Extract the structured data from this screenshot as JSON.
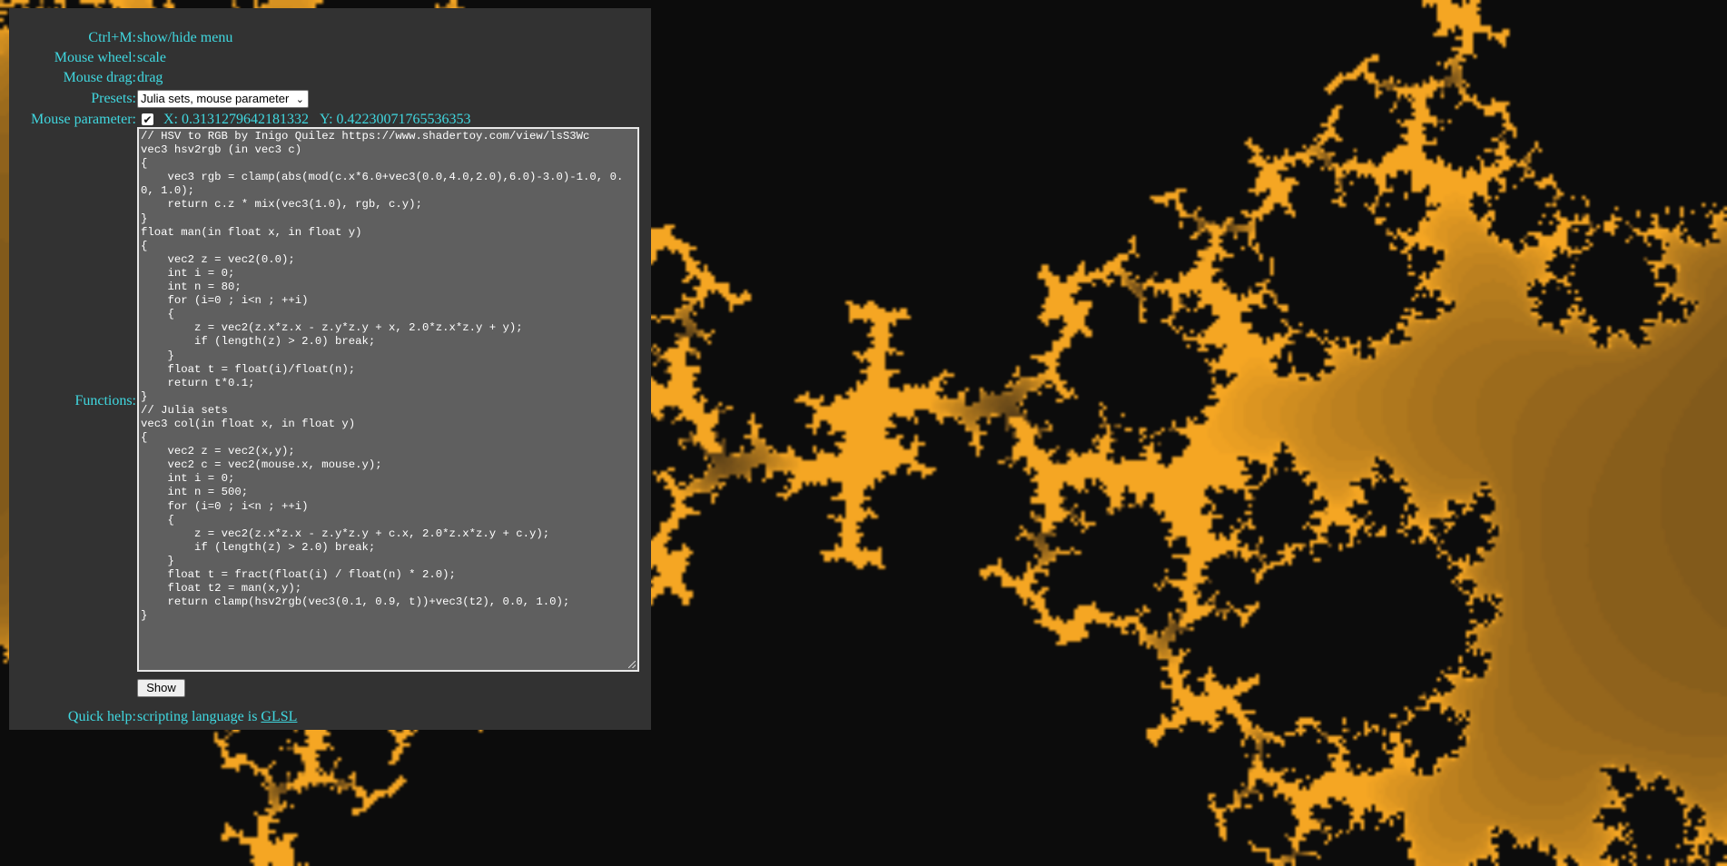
{
  "help": [
    {
      "key": "Ctrl+M:",
      "value": "show/hide menu"
    },
    {
      "key": "Mouse wheel:",
      "value": "scale"
    },
    {
      "key": "Mouse drag:",
      "value": "drag"
    }
  ],
  "presets": {
    "label": "Presets:",
    "selected": "Julia sets, mouse parameter"
  },
  "mouse_param": {
    "label": "Mouse parameter:",
    "checked": true,
    "x": "X: 0.3131279642181332",
    "y": "Y: 0.42230071765536353"
  },
  "functions": {
    "label": "Functions:",
    "code": "// HSV to RGB by Inigo Quilez https://www.shadertoy.com/view/lsS3Wc\nvec3 hsv2rgb (in vec3 c)\n{\n    vec3 rgb = clamp(abs(mod(c.x*6.0+vec3(0.0,4.0,2.0),6.0)-3.0)-1.0, 0.0, 1.0);\n    return c.z * mix(vec3(1.0), rgb, c.y);\n}\nfloat man(in float x, in float y)\n{\n    vec2 z = vec2(0.0);\n    int i = 0;\n    int n = 80;\n    for (i=0 ; i<n ; ++i)\n    {\n        z = vec2(z.x*z.x - z.y*z.y + x, 2.0*z.x*z.y + y);\n        if (length(z) > 2.0) break;\n    }\n    float t = float(i)/float(n);\n    return t*0.1;\n}\n// Julia sets\nvec3 col(in float x, in float y)\n{\n    vec2 z = vec2(x,y);\n    vec2 c = vec2(mouse.x, mouse.y);\n    int i = 0;\n    int n = 500;\n    for (i=0 ; i<n ; ++i)\n    {\n        z = vec2(z.x*z.x - z.y*z.y + c.x, 2.0*z.x*z.y + c.y);\n        if (length(z) > 2.0) break;\n    }\n    float t = fract(float(i) / float(n) * 2.0);\n    float t2 = man(x,y);\n    return clamp(hsv2rgb(vec3(0.1, 0.9, t))+vec3(t2), 0.0, 1.0);\n}"
  },
  "show_button": "Show",
  "quick_help": {
    "label": "Quick help:",
    "text": "scripting language is ",
    "link": "GLSL"
  },
  "colors": {
    "accent_cyan": "#40d8e0",
    "fractal_orange": "#f5a623",
    "background": "#1b1b1b",
    "panel": "#323232"
  }
}
